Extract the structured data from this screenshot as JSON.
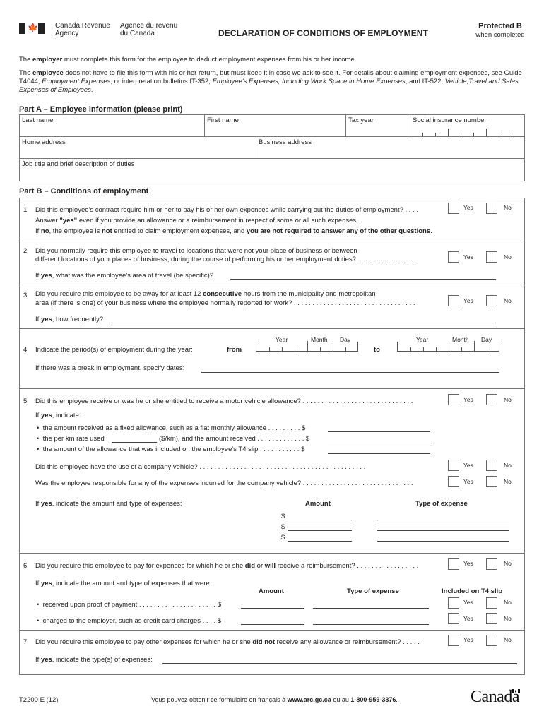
{
  "header": {
    "agency_en_line1": "Canada Revenue",
    "agency_en_line2": "Agency",
    "agency_fr_line1": "Agence du revenu",
    "agency_fr_line2": "du Canada",
    "title": "DECLARATION OF CONDITIONS OF EMPLOYMENT",
    "protected": "Protected B",
    "protected_sub": "when completed",
    "flag_icon": "canada-flag-icon"
  },
  "intro": {
    "p1_pre": "The ",
    "p1_bold": "employer",
    "p1_post": " must complete this form for the employee to deduct employment expenses from his or her income.",
    "p2_pre": "The ",
    "p2_bold": "employee",
    "p2_a": " does not have to file this form with his or her return, but must keep it in case we ask to see it. For details about claiming employment expenses, see Guide T4044, ",
    "p2_i1": "Employment Expenses",
    "p2_b": ", or interpretation bulletins IT-352, ",
    "p2_i2": "Employee's Expenses, Including Work Space in Home Expenses",
    "p2_c": ", and IT-522, ",
    "p2_i3": "Vehicle,Travel and Sales Expenses of Employees",
    "p2_d": "."
  },
  "part_a": {
    "title": "Part A – Employee information (please print)",
    "fields": {
      "last_name": "Last name",
      "first_name": "First name",
      "tax_year": "Tax year",
      "sin": "Social insurance number",
      "home_address": "Home address",
      "business_address": "Business address",
      "job_title": "Job title and brief description of duties"
    }
  },
  "part_b": {
    "title": "Part B – Conditions of employment",
    "yes": "Yes",
    "no": "No",
    "q1": {
      "num": "1.",
      "text": "Did this employee's contract require him or her to pay his or her own expenses while carrying out the duties of employment? . . . .",
      "note1_pre": "Answer ",
      "note1_bold": "\"yes\"",
      "note1_post": " even if you provide an allowance or a reimbursement in respect of some or all such expenses.",
      "note2_a": "If ",
      "note2_b": "no",
      "note2_c": ", the employee is ",
      "note2_d": "not",
      "note2_e": " entitled to claim employment expenses, and ",
      "note2_f": "you are not required to answer any of the other questions",
      "note2_g": "."
    },
    "q2": {
      "num": "2.",
      "line1": "Did you normally require this employee to travel to locations that were not your place of business or between",
      "line2": "different locations of your places of business, during the course of performing his or her employment duties? . . . . . . . . . . . . . . . .",
      "follow_a": "If ",
      "follow_b": "yes",
      "follow_c": ", what was the employee's area of travel (be specific)?"
    },
    "q3": {
      "num": "3.",
      "line1_a": "Did you require this employee to be away for at least 12 ",
      "line1_b": "consecutive",
      "line1_c": " hours from the municipality and metropolitan",
      "line2": "area (if there is one) of your business where the employee normally reported for work? . . . . . . . . . . . . . . . . . . . . . . . . . . . . . . . . .",
      "follow_a": "If ",
      "follow_b": "yes",
      "follow_c": ", how frequently?"
    },
    "q4": {
      "num": "4.",
      "text": "Indicate the period(s) of employment during the year:",
      "from": "from",
      "to": "to",
      "year": "Year",
      "month": "Month",
      "day": "Day",
      "break": "If there was a break in employment, specify dates:"
    },
    "q5": {
      "num": "5.",
      "text": "Did this employee receive or was he or she entitled to receive a motor vehicle allowance? . . . . . . . . . . . . . . . . . . . . . . . . . . . . . .",
      "if_a": "If ",
      "if_b": "yes",
      "if_c": ", indicate:",
      "b1": "the amount received as a fixed allowance, such as a flat monthly allowance . . . . . . . . . $",
      "b2_a": "the per km rate used",
      "b2_b": "($/km), and the amount received  . . . . . . . . . . . . . $",
      "b3": "the amount of the allowance that was included on the employee's T4 slip  . . . . . . . . . . . $",
      "company_vehicle": "Did this employee have the use of a company vehicle? . . . . . . . . . . . . . . . . . . . . . . . . . . . . . . . . . . . . . . . . . . . . .",
      "responsible": "Was the employee responsible for any of the expenses incurred for the company vehicle? . . . . . . . . . . . . . . . . . . . . . . . . . . . . . .",
      "exp_a": "If ",
      "exp_b": "yes",
      "exp_c": ", indicate the amount and type of expenses:",
      "amount": "Amount",
      "type": "Type of expense",
      "dollar": "$"
    },
    "q6": {
      "num": "6.",
      "text_a": "Did you require this employee to pay for expenses for which he or she ",
      "text_b": "did",
      "text_c": " or ",
      "text_d": "will",
      "text_e": " receive a reimbursement? . . . . . . . . . . . . . . . . .",
      "if_a": "If ",
      "if_b": "yes",
      "if_c": ", indicate the amount and type of expenses that were:",
      "amount": "Amount",
      "type": "Type of expense",
      "t4": "Included on T4 slip",
      "b1": "received upon proof of payment . . . . . . . . . . . . . . . . . . . . .  $",
      "b2": "charged to the employer, such as credit card charges  . . . .  $"
    },
    "q7": {
      "num": "7.",
      "text_a": "Did you require this employee to pay other expenses for which he or she ",
      "text_b": "did not",
      "text_c": " receive any allowance or reimbursement? . . . . .",
      "if_a": "If ",
      "if_b": "yes",
      "if_c": ", indicate the type(s) of expenses:"
    }
  },
  "footer": {
    "form_id": "T2200 E (12)",
    "french_a": "Vous pouvez obtenir ce formulaire en français à ",
    "french_url": "www.arc.gc.ca",
    "french_b": " ou au ",
    "french_phone": "1-800-959-3376",
    "french_c": ".",
    "wordmark": "Canada"
  }
}
